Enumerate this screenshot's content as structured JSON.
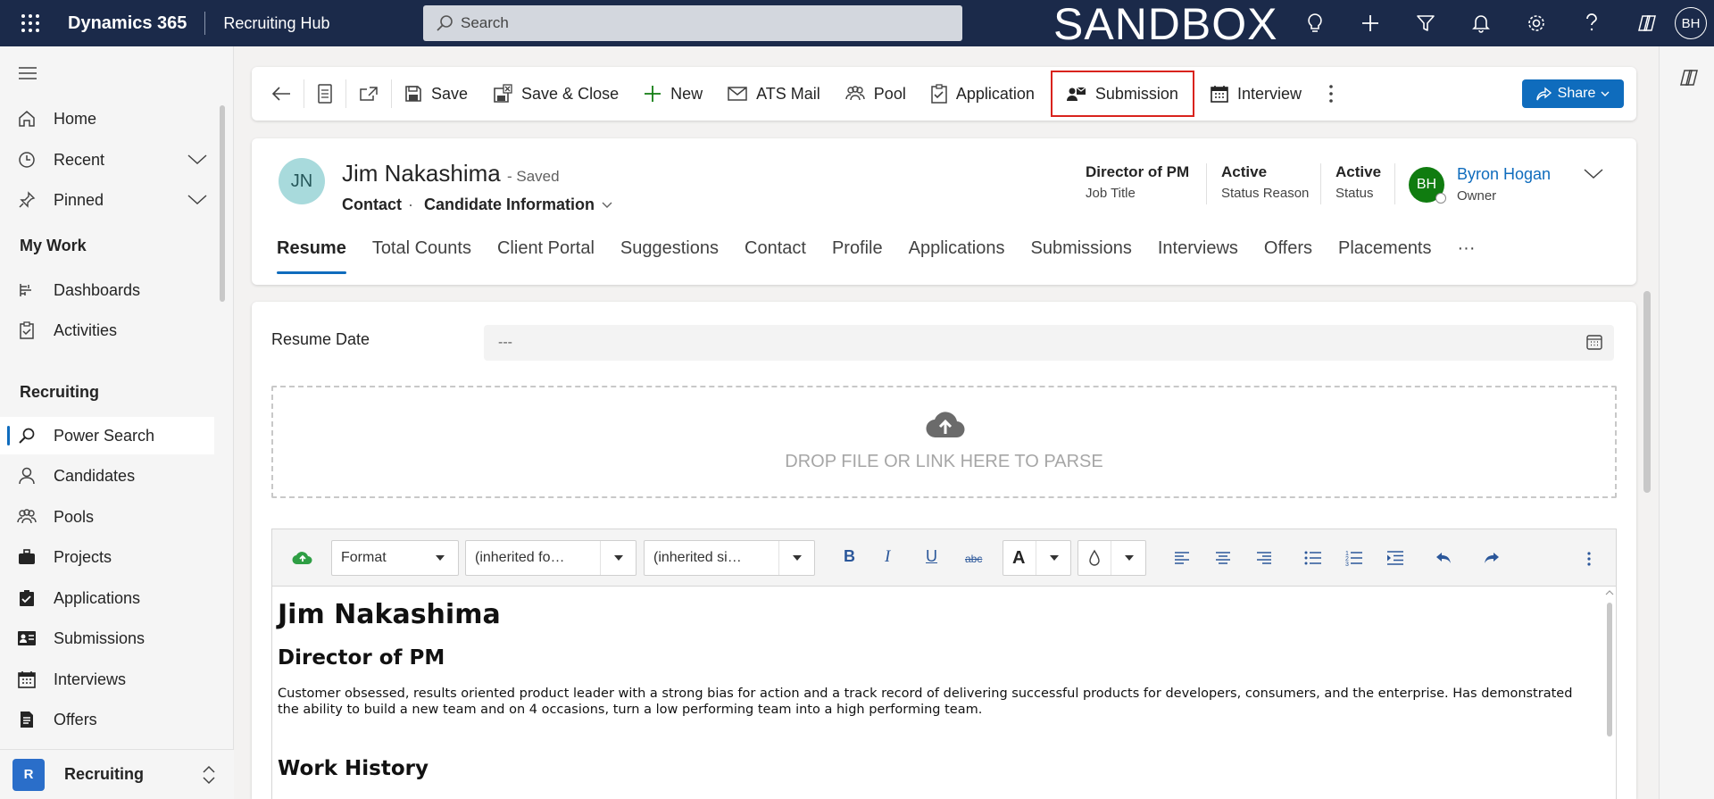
{
  "topbar": {
    "app_name": "Dynamics 365",
    "hub_name": "Recruiting Hub",
    "search_placeholder": "Search",
    "environment_banner": "SANDBOX",
    "user_initials": "BH"
  },
  "sidebar": {
    "items": [
      {
        "label": "Home",
        "icon": "home-icon"
      },
      {
        "label": "Recent",
        "icon": "clock-icon"
      },
      {
        "label": "Pinned",
        "icon": "pin-icon"
      }
    ],
    "sections": [
      {
        "title": "My Work",
        "items": [
          {
            "label": "Dashboards",
            "icon": "dashboard-icon"
          },
          {
            "label": "Activities",
            "icon": "clipboard-icon"
          }
        ]
      },
      {
        "title": "Recruiting",
        "items": [
          {
            "label": "Power Search",
            "icon": "search-icon",
            "active": true
          },
          {
            "label": "Candidates",
            "icon": "person-icon"
          },
          {
            "label": "Pools",
            "icon": "people-icon"
          },
          {
            "label": "Projects",
            "icon": "briefcase-icon"
          },
          {
            "label": "Applications",
            "icon": "checkbox-icon"
          },
          {
            "label": "Submissions",
            "icon": "contact-card-icon"
          },
          {
            "label": "Interviews",
            "icon": "calendar-icon"
          },
          {
            "label": "Offers",
            "icon": "document-icon"
          }
        ]
      }
    ],
    "area": {
      "badge": "R",
      "label": "Recruiting"
    }
  },
  "commandbar": {
    "back_icon": "back-arrow-icon",
    "buttons": [
      {
        "label": "Save",
        "icon": "save-icon"
      },
      {
        "label": "Save & Close",
        "icon": "save-close-icon"
      },
      {
        "label": "New",
        "icon": "plus-icon"
      },
      {
        "label": "ATS Mail",
        "icon": "mail-icon"
      },
      {
        "label": "Pool",
        "icon": "people-icon"
      },
      {
        "label": "Application",
        "icon": "checklist-icon"
      },
      {
        "label": "Submission",
        "icon": "submission-icon",
        "highlighted": true
      },
      {
        "label": "Interview",
        "icon": "calendar-icon"
      }
    ],
    "share_label": "Share"
  },
  "record": {
    "initials": "JN",
    "name": "Jim Nakashima",
    "saved_status": "- Saved",
    "entity": "Contact",
    "separator": "·",
    "form_name": "Candidate Information",
    "header_fields": [
      {
        "value": "Director of PM",
        "label": "Job Title"
      },
      {
        "value": "Active",
        "label": "Status Reason"
      },
      {
        "value": "Active",
        "label": "Status"
      }
    ],
    "owner": {
      "initials": "BH",
      "name": "Byron Hogan",
      "label": "Owner"
    },
    "tabs": [
      "Resume",
      "Total Counts",
      "Client Portal",
      "Suggestions",
      "Contact",
      "Profile",
      "Applications",
      "Submissions",
      "Interviews",
      "Offers",
      "Placements",
      "···"
    ],
    "active_tab": "Resume"
  },
  "resume": {
    "date_label": "Resume Date",
    "date_value": "---",
    "dropzone_text": "DROP FILE OR LINK HERE TO PARSE",
    "editor": {
      "format_label": "Format",
      "font_label": "(inherited fo…",
      "size_label": "(inherited si…",
      "font_color_glyph": "A",
      "bold_glyph": "B",
      "italic_glyph": "I",
      "underline_glyph": "U",
      "strike_glyph": "abc"
    },
    "content": {
      "heading": "Jim Nakashima",
      "subheading": "Director of PM",
      "summary": "Customer obsessed, results oriented product leader with a strong bias for action and a track record of delivering successful products for developers, consumers, and the enterprise. Has demonstrated the ability to build a new team and on 4 occasions, turn a low performing team into a high performing team.",
      "next_heading": "Work History"
    }
  },
  "colors": {
    "topbar_bg": "#1b2a4a",
    "accent": "#0f6cbd",
    "highlight_outline": "#d9231d",
    "owner_avatar": "#107c10",
    "record_avatar": "#a8dadc"
  }
}
